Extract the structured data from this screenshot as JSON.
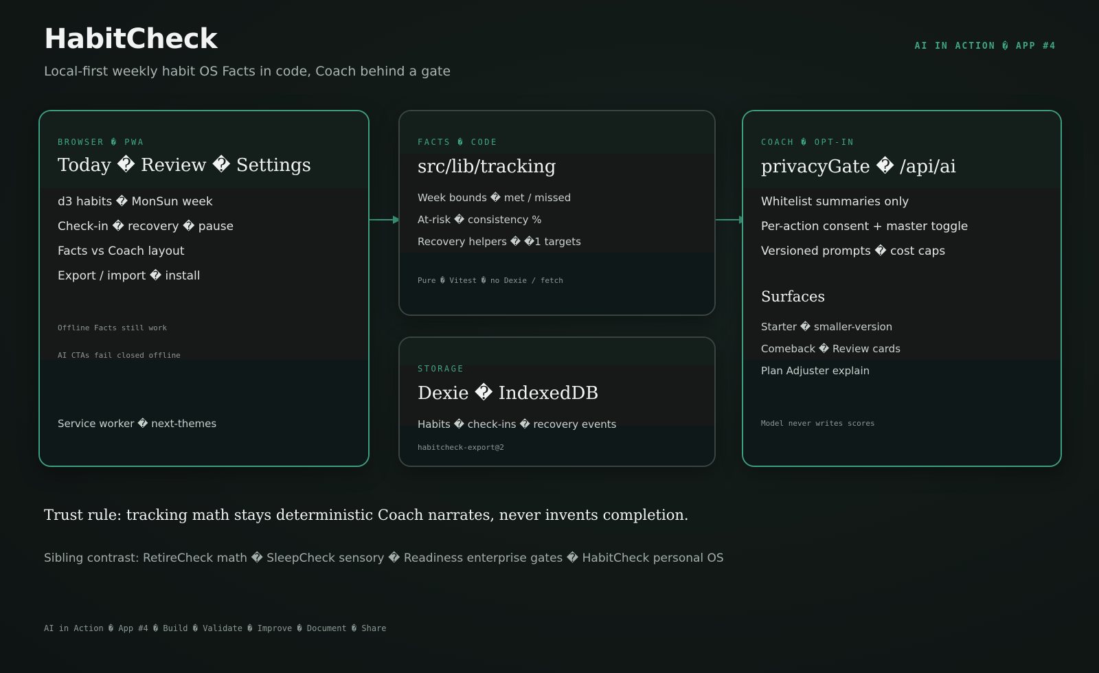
{
  "header": {
    "title": "HabitCheck",
    "subtitle": "Local-first weekly habit OS Facts in code, Coach behind a gate",
    "tag": "AI IN ACTION � APP #4"
  },
  "browser": {
    "eyebrow": "BROWSER � PWA",
    "heading": "Today � Review � Settings",
    "items": [
      "d3 habits � MonSun week",
      "Check-in � recovery � pause",
      "Facts vs Coach layout",
      "Export / import � install"
    ],
    "notes": [
      "Offline Facts still work",
      "AI CTAs fail closed offline"
    ],
    "footer": "Service worker � next-themes"
  },
  "facts": {
    "eyebrow": "FACTS � CODE",
    "heading": "src/lib/tracking",
    "items": [
      "Week bounds � met / missed",
      "At-risk � consistency %",
      "Recovery helpers � �1 targets"
    ],
    "note": "Pure � Vitest � no Dexie / fetch"
  },
  "storage": {
    "eyebrow": "STORAGE",
    "heading": "Dexie � IndexedDB",
    "item": "Habits � check-ins � recovery events",
    "note": "habitcheck-export@2"
  },
  "coach": {
    "eyebrow": "COACH � OPT-IN",
    "heading": "privacyGate � /api/ai",
    "items": [
      "Whitelist summaries only",
      "Per-action consent + master toggle",
      "Versioned prompts � cost caps"
    ],
    "surfaces_heading": "Surfaces",
    "surfaces": [
      "Starter � smaller-version",
      "Comeback � Review cards",
      "Plan Adjuster explain"
    ],
    "note": "Model never writes scores"
  },
  "trust_rule": "Trust rule: tracking math stays deterministic Coach narrates, never invents completion.",
  "sibling_contrast": "Sibling contrast: RetireCheck math � SleepCheck sensory � Readiness enterprise gates � HabitCheck personal OS",
  "footer": "AI in Action � App #4 � Build � Validate � Improve � Document � Share",
  "colors": {
    "accent": "#3fa683",
    "background": "#111816",
    "card": "#0f1918"
  }
}
